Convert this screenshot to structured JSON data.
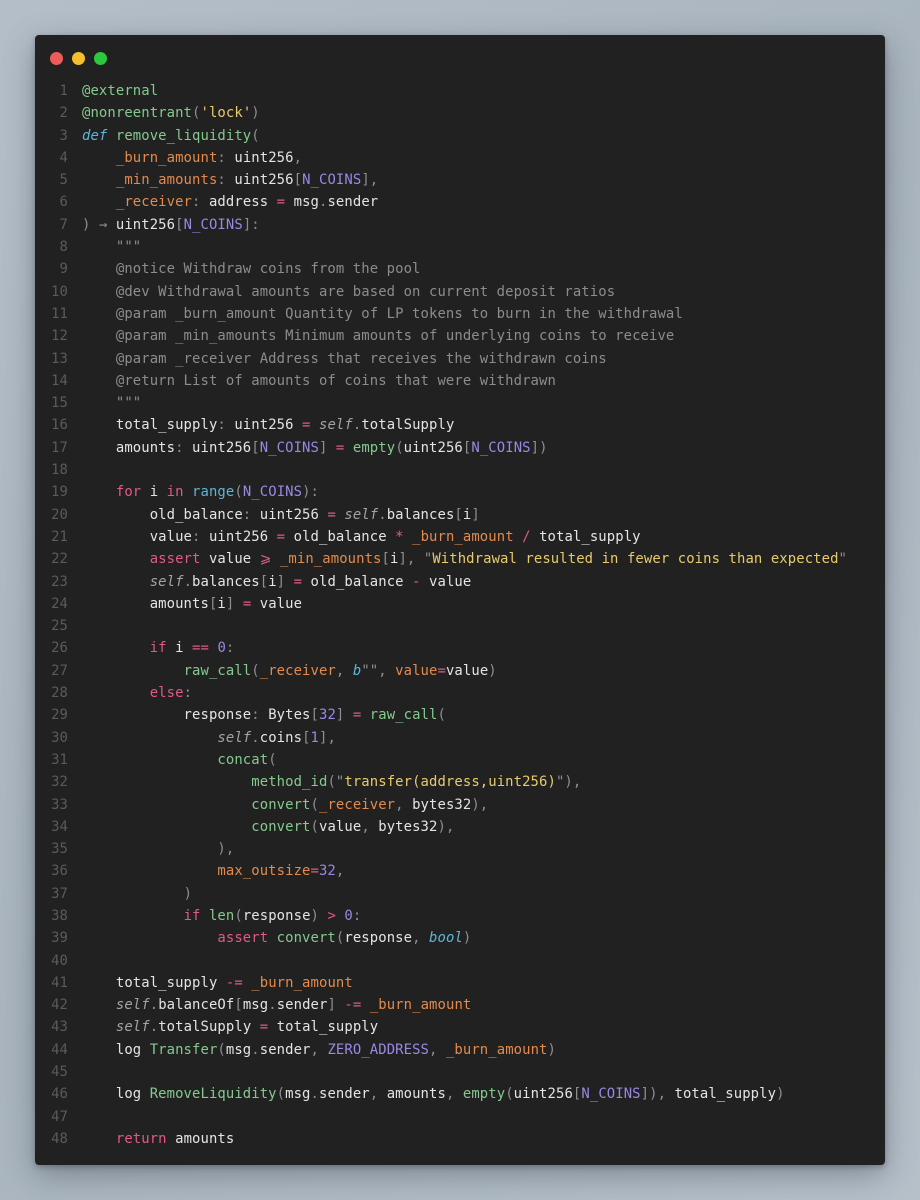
{
  "window": {
    "controls": [
      {
        "name": "close",
        "color": "#ee5c5a"
      },
      {
        "name": "minimize",
        "color": "#f5be2f"
      },
      {
        "name": "maximize",
        "color": "#2bc840"
      }
    ]
  },
  "colors": {
    "background": "#212122",
    "function": "#85c98e",
    "keyword": "#e05a86",
    "builtin_type_italic": "#5cb6d8",
    "parameter": "#e38a4c",
    "constant": "#9b88e3",
    "string": "#e9cb6a",
    "comment": "#8c8c8f"
  },
  "code": {
    "language": "vyper",
    "lines": [
      [
        [
          "deco",
          "@external"
        ]
      ],
      [
        [
          "deco",
          "@nonreentrant"
        ],
        [
          "punc",
          "("
        ],
        [
          "str",
          "'lock'"
        ],
        [
          "punc",
          ")"
        ]
      ],
      [
        [
          "def",
          "def"
        ],
        [
          "plain",
          " "
        ],
        [
          "fn",
          "remove_liquidity"
        ],
        [
          "punc",
          "("
        ]
      ],
      [
        [
          "plain",
          "    "
        ],
        [
          "param",
          "_burn_amount"
        ],
        [
          "punc",
          ":"
        ],
        [
          "plain",
          " uint256"
        ],
        [
          "punc",
          ","
        ]
      ],
      [
        [
          "plain",
          "    "
        ],
        [
          "param",
          "_min_amounts"
        ],
        [
          "punc",
          ":"
        ],
        [
          "plain",
          " uint256"
        ],
        [
          "punc",
          "["
        ],
        [
          "const",
          "N_COINS"
        ],
        [
          "punc",
          "]"
        ],
        [
          "punc",
          ","
        ]
      ],
      [
        [
          "plain",
          "    "
        ],
        [
          "param",
          "_receiver"
        ],
        [
          "punc",
          ":"
        ],
        [
          "plain",
          " address "
        ],
        [
          "op",
          "="
        ],
        [
          "plain",
          " msg"
        ],
        [
          "punc",
          "."
        ],
        [
          "plain",
          "sender"
        ]
      ],
      [
        [
          "punc",
          ")"
        ],
        [
          "plain",
          " "
        ],
        [
          "punc",
          "→"
        ],
        [
          "plain",
          " uint256"
        ],
        [
          "punc",
          "["
        ],
        [
          "const",
          "N_COINS"
        ],
        [
          "punc",
          "]"
        ],
        [
          "punc",
          ":"
        ]
      ],
      [
        [
          "com",
          "    \"\"\""
        ]
      ],
      [
        [
          "com",
          "    @notice Withdraw coins from the pool"
        ]
      ],
      [
        [
          "com",
          "    @dev Withdrawal amounts are based on current deposit ratios"
        ]
      ],
      [
        [
          "com",
          "    @param _burn_amount Quantity of LP tokens to burn in the withdrawal"
        ]
      ],
      [
        [
          "com",
          "    @param _min_amounts Minimum amounts of underlying coins to receive"
        ]
      ],
      [
        [
          "com",
          "    @param _receiver Address that receives the withdrawn coins"
        ]
      ],
      [
        [
          "com",
          "    @return List of amounts of coins that were withdrawn"
        ]
      ],
      [
        [
          "com",
          "    \"\"\""
        ]
      ],
      [
        [
          "plain",
          "    total_supply"
        ],
        [
          "punc",
          ":"
        ],
        [
          "plain",
          " uint256 "
        ],
        [
          "op",
          "="
        ],
        [
          "plain",
          " "
        ],
        [
          "self",
          "self"
        ],
        [
          "punc",
          "."
        ],
        [
          "plain",
          "totalSupply"
        ]
      ],
      [
        [
          "plain",
          "    amounts"
        ],
        [
          "punc",
          ":"
        ],
        [
          "plain",
          " uint256"
        ],
        [
          "punc",
          "["
        ],
        [
          "const",
          "N_COINS"
        ],
        [
          "punc",
          "]"
        ],
        [
          "plain",
          " "
        ],
        [
          "op",
          "="
        ],
        [
          "plain",
          " "
        ],
        [
          "fn",
          "empty"
        ],
        [
          "punc",
          "("
        ],
        [
          "plain",
          "uint256"
        ],
        [
          "punc",
          "["
        ],
        [
          "const",
          "N_COINS"
        ],
        [
          "punc",
          "])"
        ]
      ],
      [],
      [
        [
          "plain",
          "    "
        ],
        [
          "kw",
          "for"
        ],
        [
          "plain",
          " i "
        ],
        [
          "kw",
          "in"
        ],
        [
          "plain",
          " "
        ],
        [
          "def_plain",
          "range"
        ],
        [
          "punc",
          "("
        ],
        [
          "const",
          "N_COINS"
        ],
        [
          "punc",
          "):"
        ]
      ],
      [
        [
          "plain",
          "        old_balance"
        ],
        [
          "punc",
          ":"
        ],
        [
          "plain",
          " uint256 "
        ],
        [
          "op",
          "="
        ],
        [
          "plain",
          " "
        ],
        [
          "self",
          "self"
        ],
        [
          "punc",
          "."
        ],
        [
          "plain",
          "balances"
        ],
        [
          "punc",
          "["
        ],
        [
          "plain",
          "i"
        ],
        [
          "punc",
          "]"
        ]
      ],
      [
        [
          "plain",
          "        value"
        ],
        [
          "punc",
          ":"
        ],
        [
          "plain",
          " uint256 "
        ],
        [
          "op",
          "="
        ],
        [
          "plain",
          " old_balance "
        ],
        [
          "op",
          "*"
        ],
        [
          "plain",
          " "
        ],
        [
          "param",
          "_burn_amount"
        ],
        [
          "plain",
          " "
        ],
        [
          "op",
          "/"
        ],
        [
          "plain",
          " total_supply"
        ]
      ],
      [
        [
          "plain",
          "        "
        ],
        [
          "kw",
          "assert"
        ],
        [
          "plain",
          " value "
        ],
        [
          "op",
          "⩾"
        ],
        [
          "plain",
          " "
        ],
        [
          "param",
          "_min_amounts"
        ],
        [
          "punc",
          "["
        ],
        [
          "plain",
          "i"
        ],
        [
          "punc",
          "],"
        ],
        [
          "plain",
          " "
        ],
        [
          "punc",
          "\""
        ],
        [
          "str",
          "Withdrawal resulted in fewer coins than expected"
        ],
        [
          "punc",
          "\""
        ]
      ],
      [
        [
          "plain",
          "        "
        ],
        [
          "self",
          "self"
        ],
        [
          "punc",
          "."
        ],
        [
          "plain",
          "balances"
        ],
        [
          "punc",
          "["
        ],
        [
          "plain",
          "i"
        ],
        [
          "punc",
          "]"
        ],
        [
          "plain",
          " "
        ],
        [
          "op",
          "="
        ],
        [
          "plain",
          " old_balance "
        ],
        [
          "op",
          "-"
        ],
        [
          "plain",
          " value"
        ]
      ],
      [
        [
          "plain",
          "        amounts"
        ],
        [
          "punc",
          "["
        ],
        [
          "plain",
          "i"
        ],
        [
          "punc",
          "]"
        ],
        [
          "plain",
          " "
        ],
        [
          "op",
          "="
        ],
        [
          "plain",
          " value"
        ]
      ],
      [],
      [
        [
          "plain",
          "        "
        ],
        [
          "kw",
          "if"
        ],
        [
          "plain",
          " i "
        ],
        [
          "op",
          "=="
        ],
        [
          "plain",
          " "
        ],
        [
          "num",
          "0"
        ],
        [
          "punc",
          ":"
        ]
      ],
      [
        [
          "plain",
          "            "
        ],
        [
          "fn",
          "raw_call"
        ],
        [
          "punc",
          "("
        ],
        [
          "param",
          "_receiver"
        ],
        [
          "punc",
          ","
        ],
        [
          "plain",
          " "
        ],
        [
          "def",
          "b"
        ],
        [
          "punc",
          "\"\","
        ],
        [
          "plain",
          " "
        ],
        [
          "param",
          "value"
        ],
        [
          "op",
          "="
        ],
        [
          "plain",
          "value"
        ],
        [
          "punc",
          ")"
        ]
      ],
      [
        [
          "plain",
          "        "
        ],
        [
          "kw",
          "else"
        ],
        [
          "punc",
          ":"
        ]
      ],
      [
        [
          "plain",
          "            response"
        ],
        [
          "punc",
          ":"
        ],
        [
          "plain",
          " Bytes"
        ],
        [
          "punc",
          "["
        ],
        [
          "num",
          "32"
        ],
        [
          "punc",
          "]"
        ],
        [
          "plain",
          " "
        ],
        [
          "op",
          "="
        ],
        [
          "plain",
          " "
        ],
        [
          "fn",
          "raw_call"
        ],
        [
          "punc",
          "("
        ]
      ],
      [
        [
          "plain",
          "                "
        ],
        [
          "self",
          "self"
        ],
        [
          "punc",
          "."
        ],
        [
          "plain",
          "coins"
        ],
        [
          "punc",
          "["
        ],
        [
          "num",
          "1"
        ],
        [
          "punc",
          "],"
        ]
      ],
      [
        [
          "plain",
          "                "
        ],
        [
          "fn",
          "concat"
        ],
        [
          "punc",
          "("
        ]
      ],
      [
        [
          "plain",
          "                    "
        ],
        [
          "fn",
          "method_id"
        ],
        [
          "punc",
          "(\""
        ],
        [
          "str",
          "transfer(address,uint256)"
        ],
        [
          "punc",
          "\"),"
        ]
      ],
      [
        [
          "plain",
          "                    "
        ],
        [
          "fn",
          "convert"
        ],
        [
          "punc",
          "("
        ],
        [
          "param",
          "_receiver"
        ],
        [
          "punc",
          ","
        ],
        [
          "plain",
          " bytes32"
        ],
        [
          "punc",
          "),"
        ]
      ],
      [
        [
          "plain",
          "                    "
        ],
        [
          "fn",
          "convert"
        ],
        [
          "punc",
          "("
        ],
        [
          "plain",
          "value"
        ],
        [
          "punc",
          ","
        ],
        [
          "plain",
          " bytes32"
        ],
        [
          "punc",
          "),"
        ]
      ],
      [
        [
          "plain",
          "                "
        ],
        [
          "punc",
          "),"
        ]
      ],
      [
        [
          "plain",
          "                "
        ],
        [
          "param",
          "max_outsize"
        ],
        [
          "op",
          "="
        ],
        [
          "num",
          "32"
        ],
        [
          "punc",
          ","
        ]
      ],
      [
        [
          "plain",
          "            "
        ],
        [
          "punc",
          ")"
        ]
      ],
      [
        [
          "plain",
          "            "
        ],
        [
          "kw",
          "if"
        ],
        [
          "plain",
          " "
        ],
        [
          "fn",
          "len"
        ],
        [
          "punc",
          "("
        ],
        [
          "plain",
          "response"
        ],
        [
          "punc",
          ")"
        ],
        [
          "plain",
          " "
        ],
        [
          "op",
          ">"
        ],
        [
          "plain",
          " "
        ],
        [
          "num",
          "0"
        ],
        [
          "punc",
          ":"
        ]
      ],
      [
        [
          "plain",
          "                "
        ],
        [
          "kw",
          "assert"
        ],
        [
          "plain",
          " "
        ],
        [
          "fn",
          "convert"
        ],
        [
          "punc",
          "("
        ],
        [
          "plain",
          "response"
        ],
        [
          "punc",
          ","
        ],
        [
          "plain",
          " "
        ],
        [
          "def",
          "bool"
        ],
        [
          "punc",
          ")"
        ]
      ],
      [],
      [
        [
          "plain",
          "    total_supply "
        ],
        [
          "op",
          "-="
        ],
        [
          "plain",
          " "
        ],
        [
          "param",
          "_burn_amount"
        ]
      ],
      [
        [
          "plain",
          "    "
        ],
        [
          "self",
          "self"
        ],
        [
          "punc",
          "."
        ],
        [
          "plain",
          "balanceOf"
        ],
        [
          "punc",
          "["
        ],
        [
          "plain",
          "msg"
        ],
        [
          "punc",
          "."
        ],
        [
          "plain",
          "sender"
        ],
        [
          "punc",
          "]"
        ],
        [
          "plain",
          " "
        ],
        [
          "op",
          "-="
        ],
        [
          "plain",
          " "
        ],
        [
          "param",
          "_burn_amount"
        ]
      ],
      [
        [
          "plain",
          "    "
        ],
        [
          "self",
          "self"
        ],
        [
          "punc",
          "."
        ],
        [
          "plain",
          "totalSupply "
        ],
        [
          "op",
          "="
        ],
        [
          "plain",
          " total_supply"
        ]
      ],
      [
        [
          "plain",
          "    log "
        ],
        [
          "fn",
          "Transfer"
        ],
        [
          "punc",
          "("
        ],
        [
          "plain",
          "msg"
        ],
        [
          "punc",
          "."
        ],
        [
          "plain",
          "sender"
        ],
        [
          "punc",
          ","
        ],
        [
          "plain",
          " "
        ],
        [
          "const",
          "ZERO_ADDRESS"
        ],
        [
          "punc",
          ","
        ],
        [
          "plain",
          " "
        ],
        [
          "param",
          "_burn_amount"
        ],
        [
          "punc",
          ")"
        ]
      ],
      [],
      [
        [
          "plain",
          "    log "
        ],
        [
          "fn",
          "RemoveLiquidity"
        ],
        [
          "punc",
          "("
        ],
        [
          "plain",
          "msg"
        ],
        [
          "punc",
          "."
        ],
        [
          "plain",
          "sender"
        ],
        [
          "punc",
          ","
        ],
        [
          "plain",
          " amounts"
        ],
        [
          "punc",
          ","
        ],
        [
          "plain",
          " "
        ],
        [
          "fn",
          "empty"
        ],
        [
          "punc",
          "("
        ],
        [
          "plain",
          "uint256"
        ],
        [
          "punc",
          "["
        ],
        [
          "const",
          "N_COINS"
        ],
        [
          "punc",
          "]),"
        ],
        [
          "plain",
          " total_supply"
        ],
        [
          "punc",
          ")"
        ]
      ],
      [],
      [
        [
          "plain",
          "    "
        ],
        [
          "kw",
          "return"
        ],
        [
          "plain",
          " amounts"
        ]
      ]
    ]
  }
}
